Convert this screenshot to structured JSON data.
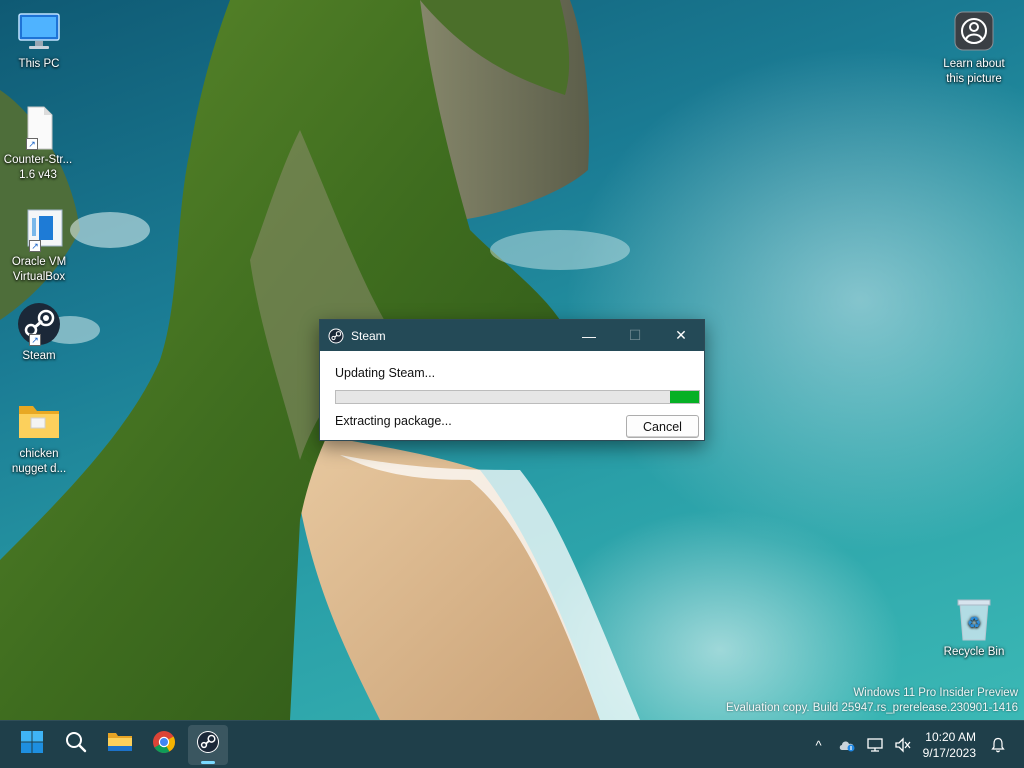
{
  "desktop": {
    "icons": [
      {
        "label": "This PC",
        "icon": "this-pc-icon"
      },
      {
        "label": "Counter-Str... 1.6 v43",
        "icon": "document-shortcut-icon"
      },
      {
        "label": "Oracle VM VirtualBox",
        "icon": "virtualbox-icon"
      },
      {
        "label": "Steam",
        "icon": "steam-icon"
      },
      {
        "label": "chicken nugget d...",
        "icon": "folder-icon"
      },
      {
        "label": "Learn about this picture",
        "icon": "camera-icon"
      },
      {
        "label": "Recycle Bin",
        "icon": "recycle-bin-icon"
      }
    ],
    "watermark": {
      "line1": "Windows 11 Pro Insider Preview",
      "line2": "Evaluation copy. Build 25947.rs_prerelease.230901-1416"
    }
  },
  "dialog": {
    "title": "Steam",
    "status": "Updating Steam...",
    "detail": "Extracting package...",
    "progress_fill_fraction": 0.08,
    "cancel_label": "Cancel",
    "minimize_glyph": "—",
    "maximize_glyph": "☐",
    "close_glyph": "✕",
    "progress_color": "#06b025"
  },
  "taskbar": {
    "apps": [
      "start-icon",
      "search-icon",
      "file-explorer-icon",
      "chrome-icon",
      "steam-icon"
    ],
    "tray": {
      "chevron": "^",
      "time": "10:20 AM",
      "date": "9/17/2023"
    },
    "background": "#1f3f4a"
  }
}
